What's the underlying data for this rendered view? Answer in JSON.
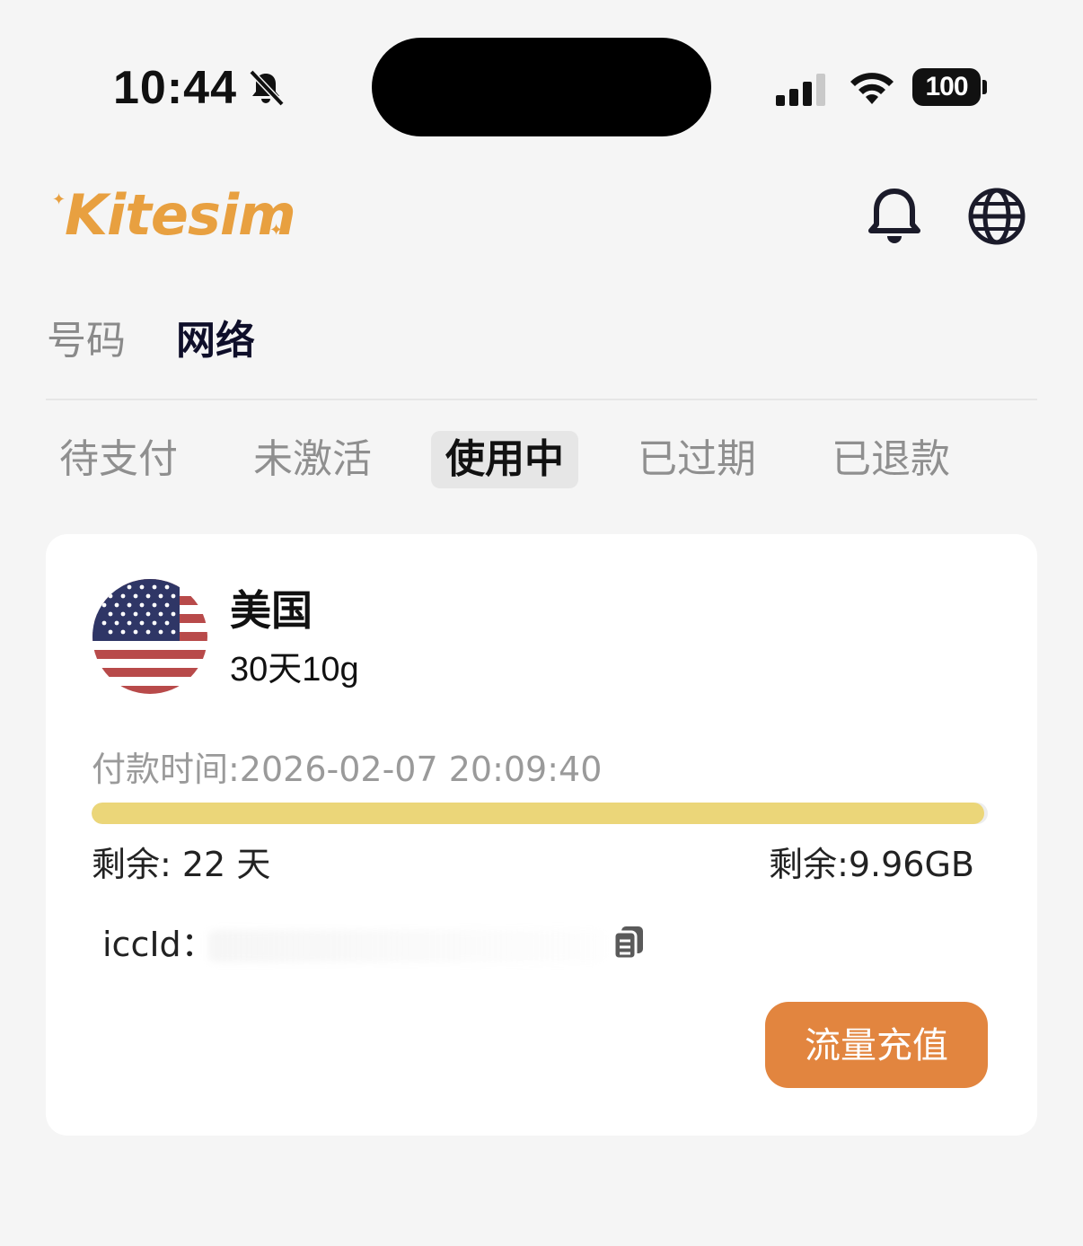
{
  "status_bar": {
    "time": "10:44",
    "battery": "100",
    "icons": [
      "mute-icon",
      "signal-icon",
      "wifi-icon",
      "battery-icon"
    ]
  },
  "header": {
    "logo": "Kitesim",
    "icons": [
      "bell-icon",
      "globe-icon"
    ],
    "brand_color": "#e8a040"
  },
  "main_tabs": [
    {
      "label": "号码",
      "active": false
    },
    {
      "label": "网络",
      "active": true
    }
  ],
  "sub_tabs": [
    {
      "label": "待支付",
      "active": false
    },
    {
      "label": "未激活",
      "active": false
    },
    {
      "label": "使用中",
      "active": true
    },
    {
      "label": "已过期",
      "active": false
    },
    {
      "label": "已退款",
      "active": false
    }
  ],
  "card": {
    "country": "美国",
    "flag_icon": "us-flag-icon",
    "plan": "30天10g",
    "pay_time": "付款时间:2026-02-07 20:09:40",
    "progress": 0.996,
    "progress_color": "#ebd679",
    "remain_days": "剩余: 22 天",
    "remain_data": "剩余:9.96GB",
    "iccid_label": "iccId：",
    "recharge_label": "流量充值",
    "recharge_color": "#e2853f"
  }
}
